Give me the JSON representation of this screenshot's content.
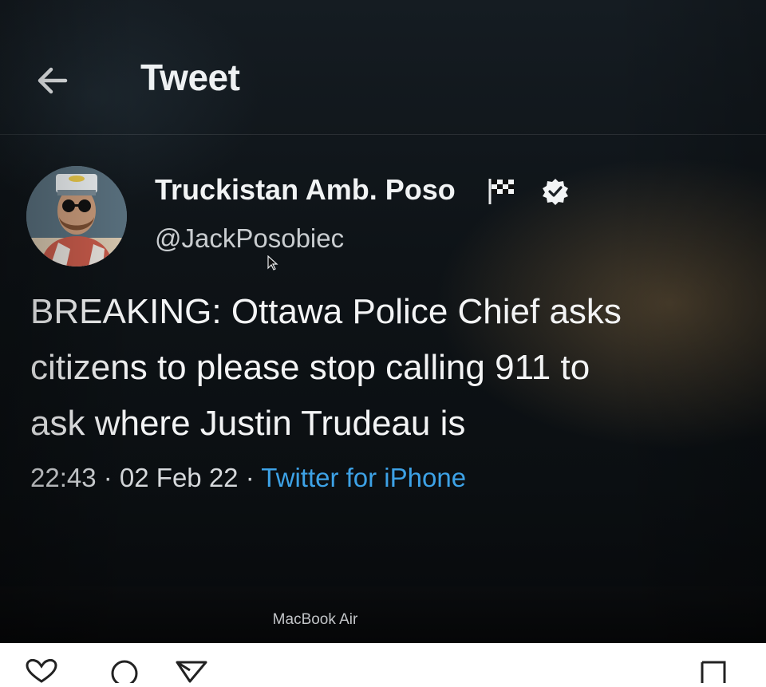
{
  "header": {
    "back_icon": "arrow-left-icon",
    "title": "Tweet"
  },
  "tweet": {
    "display_name": "Truckistan Amb. Poso",
    "flag_icon": "checkered-flag-icon",
    "verified_icon": "verified-badge-icon",
    "handle": "@JackPosobiec",
    "text_lines": [
      "BREAKING: Ottawa Police Chief asks",
      "citizens to please stop calling 911 to",
      "ask where Justin Trudeau is"
    ],
    "time": "22:43",
    "date": "02 Feb 22",
    "source": "Twitter for iPhone",
    "separator": " · "
  },
  "laptop": {
    "label": "MacBook Air"
  },
  "colors": {
    "link": "#3da2e6",
    "screen_bg": "#0e1317",
    "text": "#f3f4f5"
  },
  "action_bar": {
    "icons": [
      "heart-icon",
      "comment-icon",
      "share-icon",
      "bookmark-icon"
    ]
  }
}
